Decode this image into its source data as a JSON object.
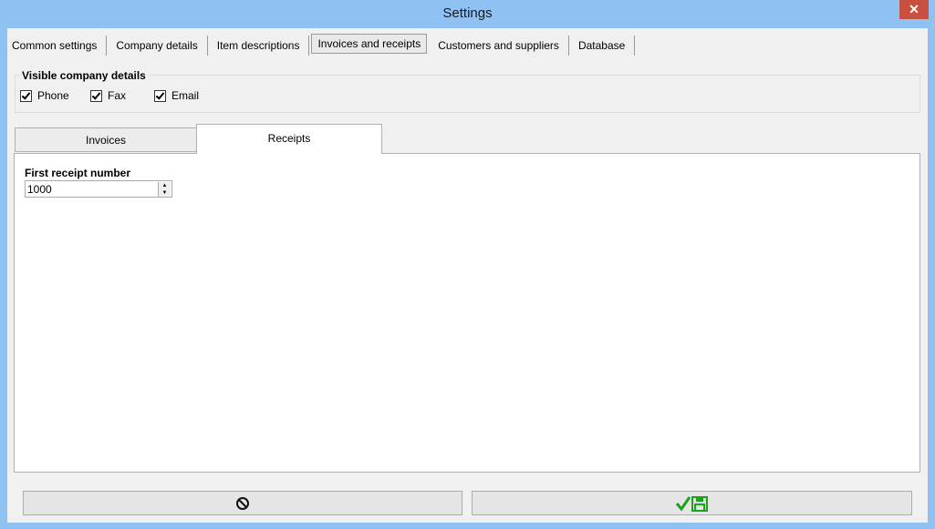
{
  "window": {
    "title": "Settings",
    "close_label": "✕"
  },
  "menu_tabs": [
    "Common settings",
    "Company details",
    "Item descriptions",
    "Invoices and receipts",
    "Customers and suppliers",
    "Database"
  ],
  "visible_company_details": {
    "title": "Visible company details",
    "options": [
      "Phone",
      "Fax",
      "Email"
    ]
  },
  "inner_tabs": [
    "Invoices",
    "Receipts"
  ],
  "receipts": {
    "label": "First receipt number",
    "value": "1000"
  },
  "buttons": {
    "cancel_icon": "cancel-icon",
    "save_icon": "save-check-icon"
  },
  "colors": {
    "save_green": "#1aa31a",
    "title_bar": "#8fc2f3",
    "close_red": "#c7503f"
  }
}
